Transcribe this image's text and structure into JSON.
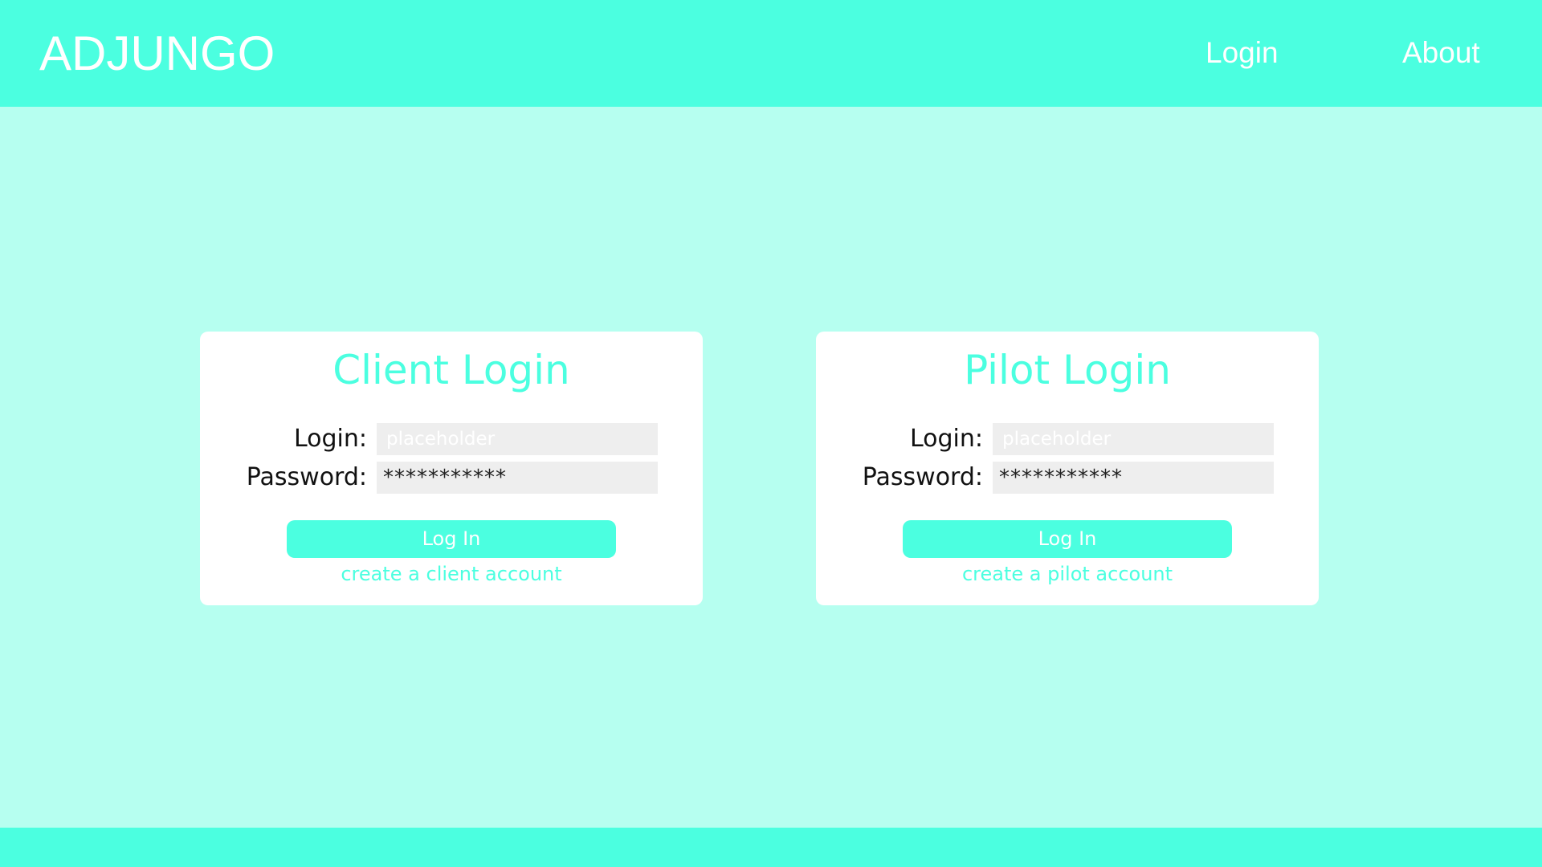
{
  "header": {
    "brand": "ADJUNGO",
    "nav": {
      "login": "Login",
      "about": "About"
    }
  },
  "colors": {
    "accent": "#4bffe0",
    "background": "#b6fff0",
    "card": "#ffffff",
    "input_background": "#eeeeee"
  },
  "client": {
    "title": "Client Login",
    "login_label": "Login:",
    "password_label": "Password:",
    "login_value": "",
    "login_placeholder": "placeholder",
    "password_value": "***********",
    "button_label": "Log In",
    "create_link": "create a client account"
  },
  "pilot": {
    "title": "Pilot Login",
    "login_label": "Login:",
    "password_label": "Password:",
    "login_value": "",
    "login_placeholder": "placeholder",
    "password_value": "***********",
    "button_label": "Log In",
    "create_link": "create a pilot account"
  }
}
